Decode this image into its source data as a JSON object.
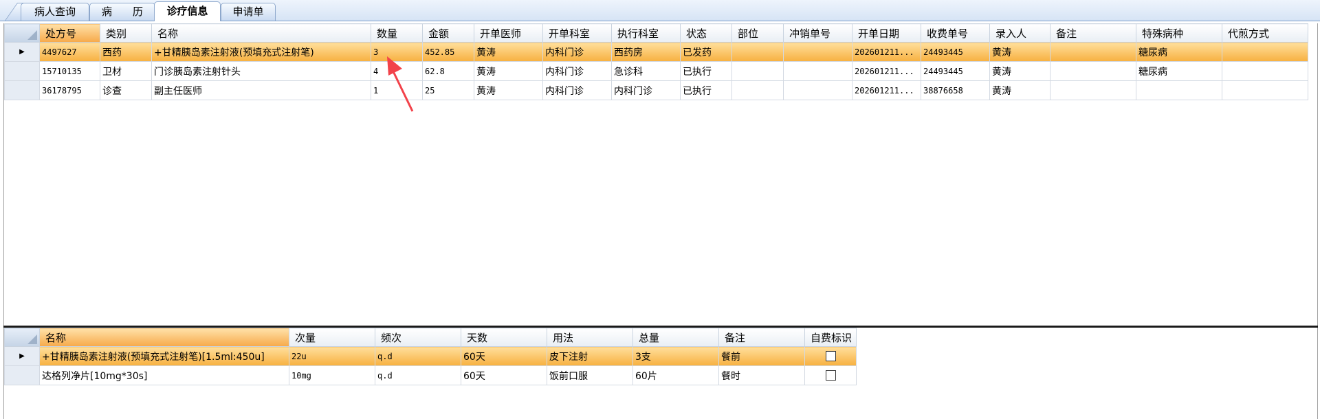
{
  "tabs": [
    {
      "label": "病人查询",
      "active": false
    },
    {
      "label": "病　　历",
      "active": false
    },
    {
      "label": "诊疗信息",
      "active": true
    },
    {
      "label": "申请单",
      "active": false
    }
  ],
  "orders": {
    "columns": [
      "处方号",
      "类别",
      "名称",
      "数量",
      "金额",
      "开单医师",
      "开单科室",
      "执行科室",
      "状态",
      "部位",
      "冲销单号",
      "开单日期",
      "收费单号",
      "录入人",
      "备注",
      "特殊病种",
      "代煎方式"
    ],
    "rows": [
      {
        "selected": true,
        "cells": [
          "4497627",
          "西药",
          "+甘精胰岛素注射液(预填充式注射笔)",
          "3",
          "452.85",
          "黄涛",
          "内科门诊",
          "西药房",
          "已发药",
          "",
          "",
          "202601211...",
          "24493445",
          "黄涛",
          "",
          "糖尿病",
          ""
        ]
      },
      {
        "selected": false,
        "cells": [
          "15710135",
          "卫材",
          "门诊胰岛素注射针头",
          "4",
          "62.8",
          "黄涛",
          "内科门诊",
          "急诊科",
          "已执行",
          "",
          "",
          "202601211...",
          "24493445",
          "黄涛",
          "",
          "糖尿病",
          ""
        ]
      },
      {
        "selected": false,
        "cells": [
          "36178795",
          "诊查",
          "副主任医师",
          "1",
          "25",
          "黄涛",
          "内科门诊",
          "内科门诊",
          "已执行",
          "",
          "",
          "202601211...",
          "38876658",
          "黄涛",
          "",
          "",
          ""
        ]
      }
    ]
  },
  "details": {
    "columns": [
      "名称",
      "次量",
      "频次",
      "天数",
      "用法",
      "总量",
      "备注",
      "自费标识"
    ],
    "rows": [
      {
        "selected": true,
        "cells": [
          "+甘精胰岛素注射液(预填充式注射笔)[1.5ml:450u]",
          "22u",
          "q.d",
          "60天",
          "皮下注射",
          "3支",
          "餐前"
        ],
        "self_pay": false
      },
      {
        "selected": false,
        "cells": [
          "达格列净片[10mg*30s]",
          "10mg",
          "q.d",
          "60天",
          "饭前口服",
          "60片",
          "餐时"
        ],
        "self_pay": false
      }
    ]
  },
  "colors": {
    "selected_row": "#f7b040",
    "tab_border": "#8ea8cc",
    "arrow": "#f2424a"
  }
}
